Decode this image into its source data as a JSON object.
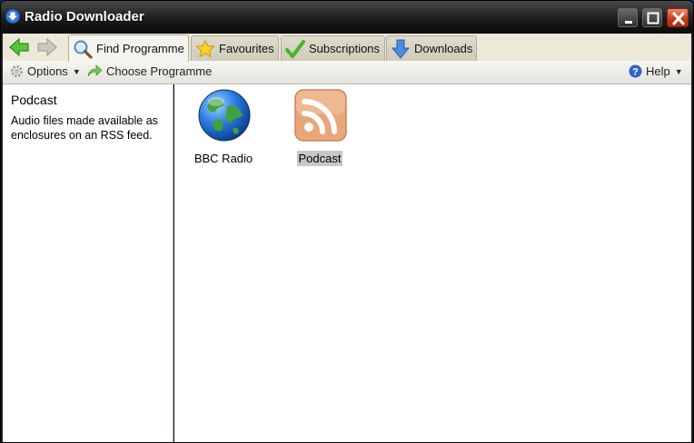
{
  "window": {
    "title": "Radio Downloader"
  },
  "tabs": [
    {
      "label": "Find Programme",
      "icon": "magnifier-icon",
      "active": true
    },
    {
      "label": "Favourites",
      "icon": "star-icon",
      "active": false
    },
    {
      "label": "Subscriptions",
      "icon": "checkmark-icon",
      "active": false
    },
    {
      "label": "Downloads",
      "icon": "download-arrow-icon",
      "active": false
    }
  ],
  "toolbar": {
    "options_label": "Options",
    "choose_label": "Choose Programme",
    "help_label": "Help"
  },
  "sidebar": {
    "title": "Podcast",
    "description": "Audio files made available as enclosures on an RSS feed."
  },
  "providers": [
    {
      "label": "BBC Radio",
      "icon": "globe-icon",
      "selected": false
    },
    {
      "label": "Podcast",
      "icon": "rss-feed-icon",
      "selected": true
    }
  ],
  "colors": {
    "accent_blue": "#3a6ec8",
    "rss_orange": "#e8a77a",
    "close_red": "#c83618"
  }
}
